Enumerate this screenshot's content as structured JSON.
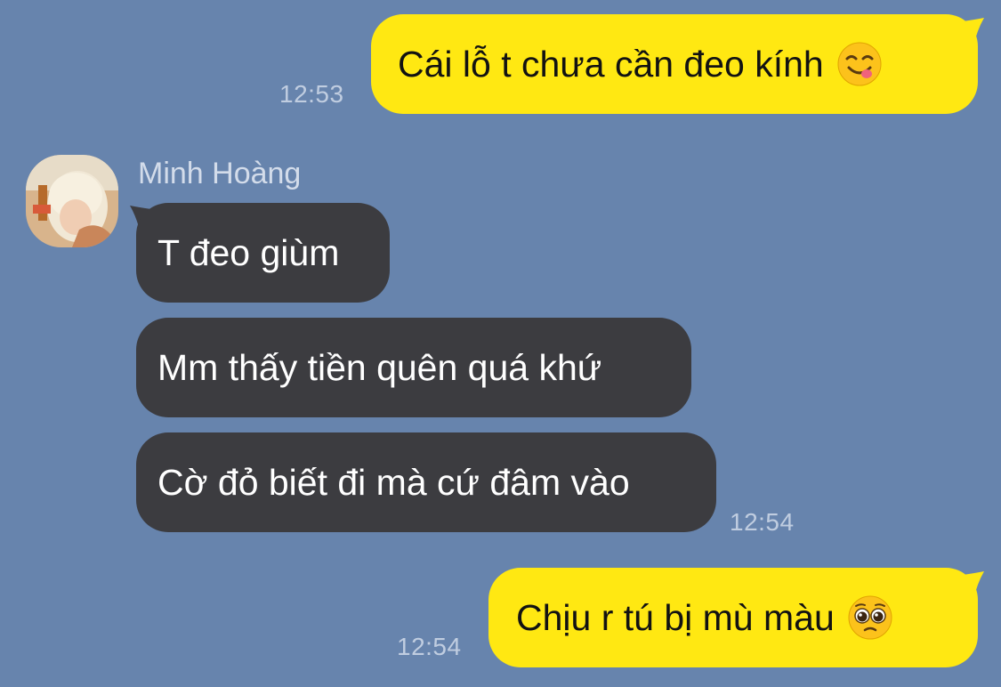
{
  "colors": {
    "background": "#6784ad",
    "outgoing_bubble": "#ffe812",
    "incoming_bubble": "#3c3c40",
    "timestamp": "#c0cde0"
  },
  "messages": [
    {
      "direction": "outgoing",
      "text": "Cái lỗ t chưa cần đeo kính",
      "emoji": "yum-face-icon",
      "time": "12:53"
    },
    {
      "direction": "incoming",
      "sender": "Minh Hoàng",
      "avatar": "user-avatar-photo",
      "text": "T đeo giùm"
    },
    {
      "direction": "incoming",
      "text": "Mm thấy tiền quên quá khứ"
    },
    {
      "direction": "incoming",
      "text": "Cờ đỏ biết đi mà cứ đâm vào",
      "time": "12:54"
    },
    {
      "direction": "outgoing",
      "text": "Chịu r tú bị mù màu",
      "emoji": "pleading-face-icon",
      "time": "12:54"
    }
  ]
}
